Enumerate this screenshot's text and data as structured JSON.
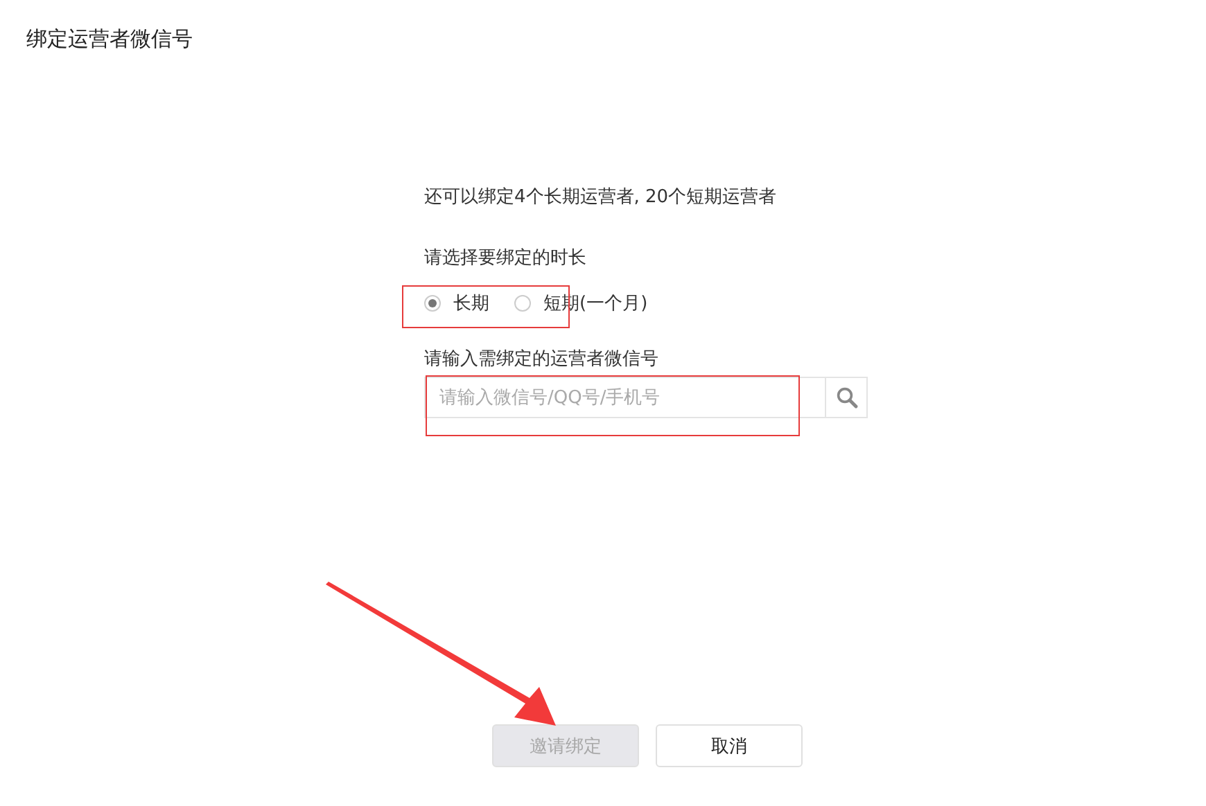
{
  "dialog": {
    "title": "绑定运营者微信号"
  },
  "quota_text": "还可以绑定4个长期运营者, 20个短期运营者",
  "duration": {
    "label": "请选择要绑定的时长",
    "options": [
      {
        "label": "长期",
        "selected": true
      },
      {
        "label": "短期(一个月)",
        "selected": false
      }
    ]
  },
  "wechat_id": {
    "label": "请输入需绑定的运营者微信号",
    "placeholder": "请输入微信号/QQ号/手机号"
  },
  "buttons": [
    {
      "label": "邀请绑定",
      "disabled": true
    },
    {
      "label": "取消",
      "disabled": false
    }
  ],
  "annotations": [
    {
      "kind": "box"
    },
    {
      "kind": "box"
    },
    {
      "kind": "arrow"
    }
  ]
}
